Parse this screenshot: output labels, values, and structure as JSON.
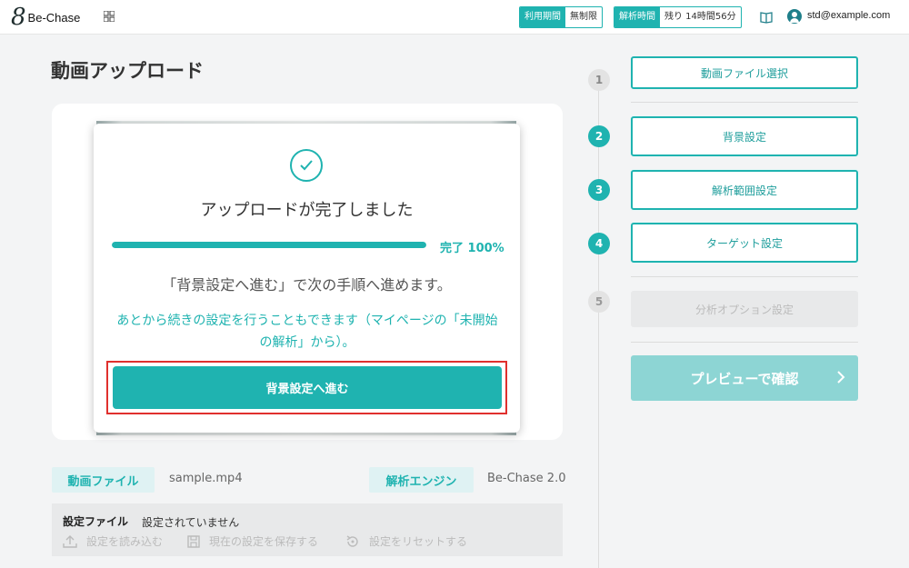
{
  "header": {
    "logo_mark": "8",
    "logo_text": "Be-Chase",
    "usage": {
      "label": "利用期間",
      "value": "無制限"
    },
    "analysis_time": {
      "label": "解析時間",
      "value": "残り 14時間56分"
    },
    "user_email": "std@example.com"
  },
  "page": {
    "title": "動画アップロード"
  },
  "modal": {
    "title": "アップロードが完了しました",
    "progress_percent": 100,
    "progress_label": "完了 100%",
    "next_text": "「背景設定へ進む」で次の手順へ進めます。",
    "later_text": "あとから続きの設定を行うこともできます（マイページの「未開始の解析」から）。",
    "primary_button": "背景設定へ進む"
  },
  "file_info": {
    "video_label": "動画ファイル",
    "video_value": "sample.mp4",
    "engine_label": "解析エンジン",
    "engine_value": "Be-Chase 2.0"
  },
  "settings_file": {
    "label": "設定ファイル",
    "value": "設定されていません",
    "load": "設定を読み込む",
    "save": "現在の設定を保存する",
    "reset": "設定をリセットする"
  },
  "steps": [
    {
      "num": "1",
      "label": "動画ファイル選択",
      "state": "done"
    },
    {
      "num": "2",
      "label": "背景設定",
      "state": "active"
    },
    {
      "num": "3",
      "label": "解析範囲設定",
      "state": "active"
    },
    {
      "num": "4",
      "label": "ターゲット設定",
      "state": "active"
    },
    {
      "num": "5",
      "label": "分析オプション設定",
      "state": "disabled"
    }
  ],
  "preview_button": "プレビューで確認",
  "colors": {
    "accent": "#1fb3b0",
    "highlight_border": "#e0302d"
  }
}
